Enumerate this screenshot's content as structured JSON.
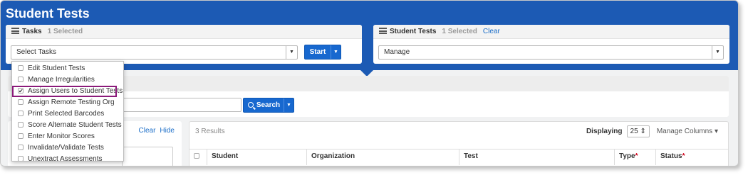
{
  "page": {
    "title": "Student Tests",
    "accent": "#1c5ab4",
    "highlight": "#8b1a7a"
  },
  "tasks_panel": {
    "title": "Tasks",
    "selected": "1 Selected",
    "select_placeholder": "Select Tasks",
    "start_label": "Start"
  },
  "student_tests_panel": {
    "title": "Student Tests",
    "selected": "1 Selected",
    "clear_label": "Clear",
    "select_value": "Manage"
  },
  "search": {
    "button_label": "Search"
  },
  "filters": {
    "clear_label": "Clear",
    "hide_label": "Hide"
  },
  "results": {
    "count": "3 Results",
    "displaying_label": "Displaying",
    "page_size": "25",
    "manage_columns": "Manage Columns",
    "columns": [
      "Student",
      "Organization",
      "Test",
      "Type",
      "Status"
    ],
    "required_mark": "*"
  },
  "task_menu": {
    "items": [
      {
        "label": "Edit Student Tests",
        "checked": false
      },
      {
        "label": "Manage Irregularities",
        "checked": false
      },
      {
        "label": "Assign Users to Student Tests",
        "checked": true
      },
      {
        "label": "Assign Remote Testing Org",
        "checked": false
      },
      {
        "label": "Print Selected Barcodes",
        "checked": false
      },
      {
        "label": "Score Alternate Student Tests",
        "checked": false
      },
      {
        "label": "Enter Monitor Scores",
        "checked": false
      },
      {
        "label": "Invalidate/Validate Tests",
        "checked": false
      },
      {
        "label": "Unextract Assessments",
        "checked": false
      }
    ]
  }
}
